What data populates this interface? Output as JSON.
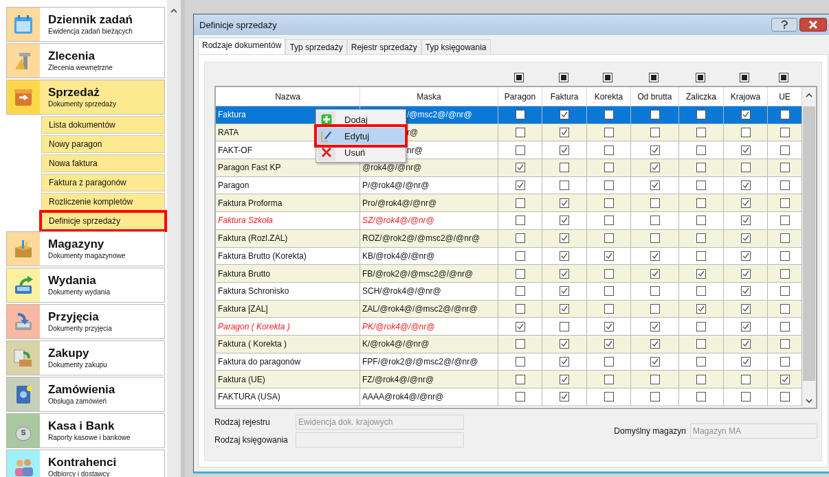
{
  "sidebar": {
    "items": [
      {
        "title": "Dziennik zadań",
        "subtitle": "Ewidencja zadań bieżących",
        "color": "#fdd99b",
        "selected": false
      },
      {
        "title": "Zlecenia",
        "subtitle": "Zlecenia wewnętrzne",
        "color": "#fdd99b",
        "selected": false
      },
      {
        "title": "Sprzedaż",
        "subtitle": "Dokumenty sprzedaży",
        "color": "#ffd84a",
        "selected": true,
        "children": [
          {
            "label": "Lista dokumentów",
            "selected": false
          },
          {
            "label": "Nowy paragon",
            "selected": false
          },
          {
            "label": "Nowa faktura",
            "selected": false
          },
          {
            "label": "Faktura z paragonów",
            "selected": false
          },
          {
            "label": "Rozliczenie kompletów",
            "selected": false
          },
          {
            "label": "Definicje sprzedaży",
            "selected": true
          }
        ]
      },
      {
        "title": "Magazyny",
        "subtitle": "Dokumenty magazynowe",
        "color": "#fdd99b",
        "selected": false
      },
      {
        "title": "Wydania",
        "subtitle": "Dokumenty wydania",
        "color": "#fdf0a0",
        "selected": false
      },
      {
        "title": "Przyjęcia",
        "subtitle": "Dokumenty przyjęcia",
        "color": "#fbb8a0",
        "selected": false
      },
      {
        "title": "Zakupy",
        "subtitle": "Dokumenty zakupu",
        "color": "#d8d4a8",
        "selected": false
      },
      {
        "title": "Zamówienia",
        "subtitle": "Obsługa zamówień",
        "color": "#c8cfb8",
        "selected": false
      },
      {
        "title": "Kasa i Bank",
        "subtitle": "Raporty kasowe i bankowe",
        "color": "#a8c8a0",
        "selected": false
      },
      {
        "title": "Kontrahenci",
        "subtitle": "Odbiorcy i dostawcy",
        "color": "#a0f0f8",
        "selected": false
      }
    ]
  },
  "dialog": {
    "title": "Definicje sprzedaży",
    "tabs": [
      {
        "label": "Rodzaje dokumentów",
        "selected": true
      },
      {
        "label": "Typ sprzedaży",
        "selected": false
      },
      {
        "label": "Rejestr sprzedaży",
        "selected": false
      },
      {
        "label": "Typ księgowania",
        "selected": false
      }
    ],
    "table": {
      "header_checks": [
        {
          "indeterminate": true
        },
        {
          "indeterminate": true
        },
        {
          "indeterminate": true
        },
        {
          "indeterminate": true
        },
        {
          "indeterminate": true
        },
        {
          "indeterminate": true
        },
        {
          "indeterminate": true
        }
      ],
      "columns": [
        "Nazwa",
        "Maska",
        "Paragon",
        "Faktura",
        "Korekta",
        "Od brutta",
        "Zaliczka",
        "Krajowa",
        "UE"
      ],
      "rows": [
        {
          "name": "Faktura",
          "mask": "/@msc2@/@nr@",
          "flagged": false,
          "selected": true,
          "checks": [
            false,
            true,
            false,
            false,
            false,
            true,
            false
          ]
        },
        {
          "name": "RATA",
          "mask": "r@",
          "flagged": false,
          "selected": false,
          "checks": [
            false,
            true,
            false,
            false,
            false,
            false,
            false
          ]
        },
        {
          "name": "FAKT-OF",
          "mask": "nr@",
          "flagged": false,
          "selected": false,
          "checks": [
            false,
            true,
            false,
            true,
            false,
            true,
            false
          ]
        },
        {
          "name": "Paragon Fast KP",
          "mask": "@rok4@/@nr@",
          "flagged": false,
          "selected": false,
          "checks": [
            true,
            false,
            false,
            true,
            false,
            false,
            false
          ]
        },
        {
          "name": "Paragon",
          "mask": "P/@rok4@/@nr@",
          "flagged": false,
          "selected": false,
          "checks": [
            true,
            false,
            false,
            true,
            false,
            true,
            false
          ]
        },
        {
          "name": "Faktura Proforma",
          "mask": "Pro/@rok4@/@nr@",
          "flagged": false,
          "selected": false,
          "checks": [
            false,
            true,
            false,
            false,
            false,
            true,
            false
          ]
        },
        {
          "name": "Faktura Szkoła",
          "mask": "SZ/@rok4@/@nr@",
          "flagged": true,
          "selected": false,
          "checks": [
            false,
            true,
            false,
            false,
            false,
            true,
            false
          ]
        },
        {
          "name": "Faktura (Rozl.ZAL)",
          "mask": "ROZ/@rok2@/@msc2@/@nr@",
          "flagged": false,
          "selected": false,
          "checks": [
            false,
            true,
            false,
            false,
            false,
            true,
            false
          ]
        },
        {
          "name": "Faktura Brutto (Korekta)",
          "mask": "KB/@rok4@/@nr@",
          "flagged": false,
          "selected": false,
          "checks": [
            false,
            true,
            true,
            true,
            false,
            true,
            false
          ]
        },
        {
          "name": "Faktura Brutto",
          "mask": "FB/@rok2@/@msc2@/@nr@",
          "flagged": false,
          "selected": false,
          "checks": [
            false,
            true,
            false,
            true,
            true,
            true,
            false
          ]
        },
        {
          "name": "Faktura Schronisko",
          "mask": "SCH/@rok4@/@nr@",
          "flagged": false,
          "selected": false,
          "checks": [
            false,
            true,
            false,
            false,
            false,
            true,
            false
          ]
        },
        {
          "name": "Faktura [ZAL]",
          "mask": "ZAL/@rok4@/@msc2@/@nr@",
          "flagged": false,
          "selected": false,
          "checks": [
            false,
            true,
            false,
            false,
            true,
            true,
            false
          ]
        },
        {
          "name": "Paragon ( Korekta )",
          "mask": "PK/@rok4@/@nr@",
          "flagged": true,
          "selected": false,
          "checks": [
            true,
            false,
            true,
            true,
            false,
            true,
            false
          ]
        },
        {
          "name": "Faktura ( Korekta )",
          "mask": "K/@rok4@/@nr@",
          "flagged": false,
          "selected": false,
          "checks": [
            false,
            true,
            true,
            true,
            false,
            true,
            false
          ]
        },
        {
          "name": "Faktura do paragonów",
          "mask": "FPF/@rok2@/@msc2@/@nr@",
          "flagged": false,
          "selected": false,
          "checks": [
            false,
            true,
            false,
            true,
            false,
            true,
            false
          ]
        },
        {
          "name": "Faktura (UE)",
          "mask": "FZ/@rok4@/@nr@",
          "flagged": false,
          "selected": false,
          "checks": [
            false,
            true,
            false,
            false,
            false,
            false,
            true
          ]
        },
        {
          "name": "FAKTURA (USA)",
          "mask": "AAAA@rok4@/@nr@",
          "flagged": false,
          "selected": false,
          "checks": [
            false,
            true,
            false,
            false,
            false,
            false,
            false
          ]
        }
      ]
    },
    "context_menu": {
      "items": [
        {
          "label": "Dodaj",
          "selected": false
        },
        {
          "label": "Edytuj",
          "selected": true
        },
        {
          "label": "Usuń",
          "selected": false
        }
      ]
    },
    "fields": [
      {
        "label": "Rodzaj rejestru",
        "value": "Ewidencja dok. krajowych",
        "disabled": true
      },
      {
        "label": "Rodzaj księgowania",
        "disabled": true
      }
    ],
    "side_field": {
      "label": "Domyślny magazyn",
      "value": "Magazyn MA",
      "disabled": true
    }
  }
}
